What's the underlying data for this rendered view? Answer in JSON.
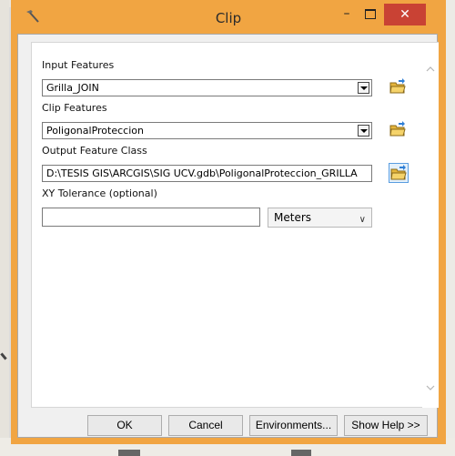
{
  "window": {
    "title": "Clip",
    "minimize_glyph": "–",
    "close_glyph": "✕",
    "icon": "hammer-icon"
  },
  "form": {
    "input_features": {
      "label": "Input Features",
      "value": "Grilla_JOIN"
    },
    "clip_features": {
      "label": "Clip Features",
      "value": "PoligonalProteccion"
    },
    "output_feature_class": {
      "label": "Output Feature Class",
      "value": "D:\\TESIS GIS\\ARCGIS\\SIG UCV.gdb\\PoligonalProteccion_GRILLA"
    },
    "xy_tolerance": {
      "label": "XY Tolerance (optional)",
      "value": "",
      "units": "Meters"
    }
  },
  "buttons": {
    "ok": "OK",
    "cancel": "Cancel",
    "environments": "Environments...",
    "show_help": "Show Help >>"
  },
  "colors": {
    "titlebar": "#f1a542",
    "close": "#c94234"
  }
}
